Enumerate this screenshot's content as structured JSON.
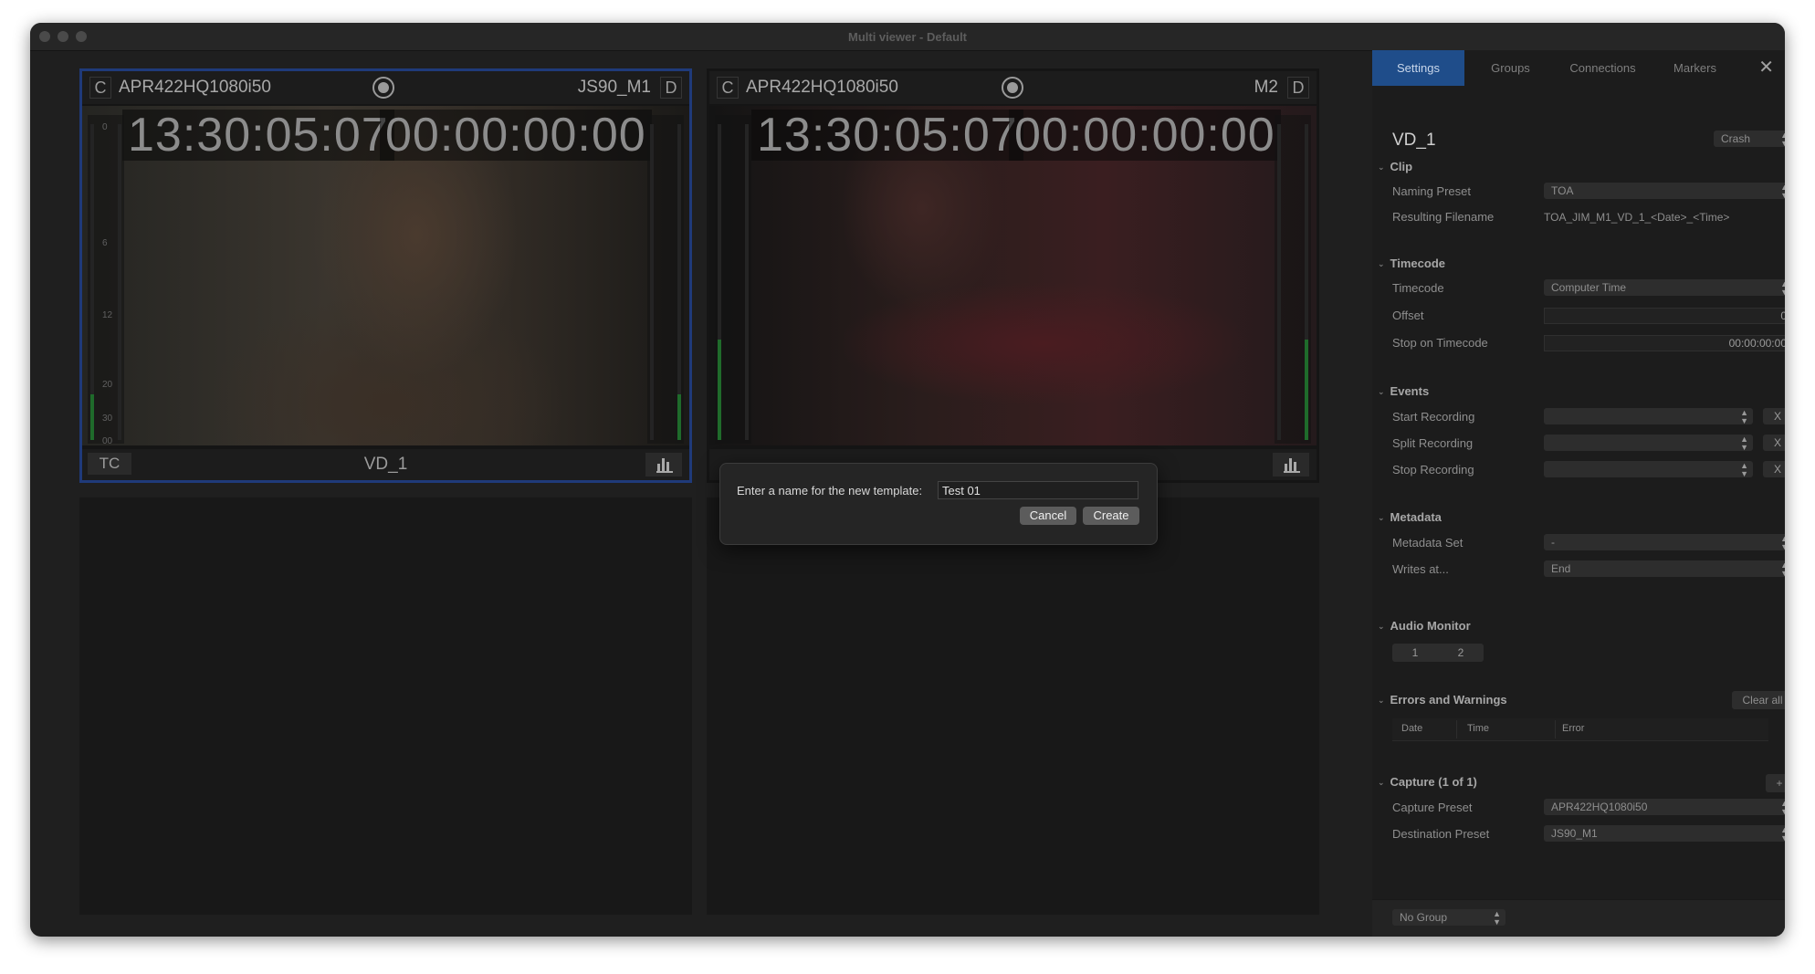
{
  "window": {
    "title": "Multi viewer - Default"
  },
  "viewers": [
    {
      "left_letter": "C",
      "preset": "APR422HQ1080i50",
      "destination": "JS90_M1",
      "right_letter": "D",
      "timecode": "13:30:05:07",
      "duration": "00:00:00:00",
      "foot_box": "TC",
      "label": "VD_1",
      "meter_ticks": [
        "0",
        "6",
        "12",
        "20",
        "30",
        "00"
      ]
    },
    {
      "left_letter": "C",
      "preset": "APR422HQ1080i50",
      "destination": "M2",
      "right_letter": "D",
      "timecode": "13:30:05:07",
      "duration": "00:00:00:00"
    }
  ],
  "dialog": {
    "prompt": "Enter a name for the new template:",
    "value": "Test 01",
    "cancel_label": "Cancel",
    "create_label": "Create"
  },
  "panel": {
    "tabs": [
      "Settings",
      "Groups",
      "Connections",
      "Markers"
    ],
    "active_tab": "Settings",
    "close_glyph": "✕",
    "title": "VD_1",
    "title_dropdown": "Crash",
    "clip": {
      "heading": "Clip",
      "naming_preset_label": "Naming Preset",
      "naming_preset_value": "TOA",
      "resulting_filename_label": "Resulting Filename",
      "resulting_filename_value": "TOA_JIM_M1_VD_1_<Date>_<Time>"
    },
    "timecode": {
      "heading": "Timecode",
      "timecode_label": "Timecode",
      "timecode_value": "Computer Time",
      "offset_label": "Offset",
      "offset_value": "0",
      "stop_label": "Stop on Timecode",
      "stop_value": "00:00:00:00"
    },
    "events": {
      "heading": "Events",
      "start_label": "Start Recording",
      "split_label": "Split Recording",
      "stop_label": "Stop Recording",
      "clear_glyph": "X"
    },
    "metadata": {
      "heading": "Metadata",
      "set_label": "Metadata Set",
      "set_value": "-",
      "writes_label": "Writes at...",
      "writes_value": "End"
    },
    "audio": {
      "heading": "Audio Monitor",
      "channels": [
        "1",
        "2"
      ]
    },
    "errors": {
      "heading": "Errors and Warnings",
      "clear_all": "Clear all",
      "columns": [
        "Date",
        "Time",
        "Error"
      ]
    },
    "capture": {
      "heading": "Capture (1 of 1)",
      "add_glyph": "+",
      "capture_preset_label": "Capture Preset",
      "capture_preset_value": "APR422HQ1080i50",
      "destination_preset_label": "Destination Preset",
      "destination_preset_value": "JS90_M1"
    },
    "footer": {
      "group_value": "No Group"
    }
  },
  "colors": {
    "accent_tab": "#1f4d8a",
    "selected_border": "#1f3a7a",
    "meter_level": "#1f6b2b"
  }
}
